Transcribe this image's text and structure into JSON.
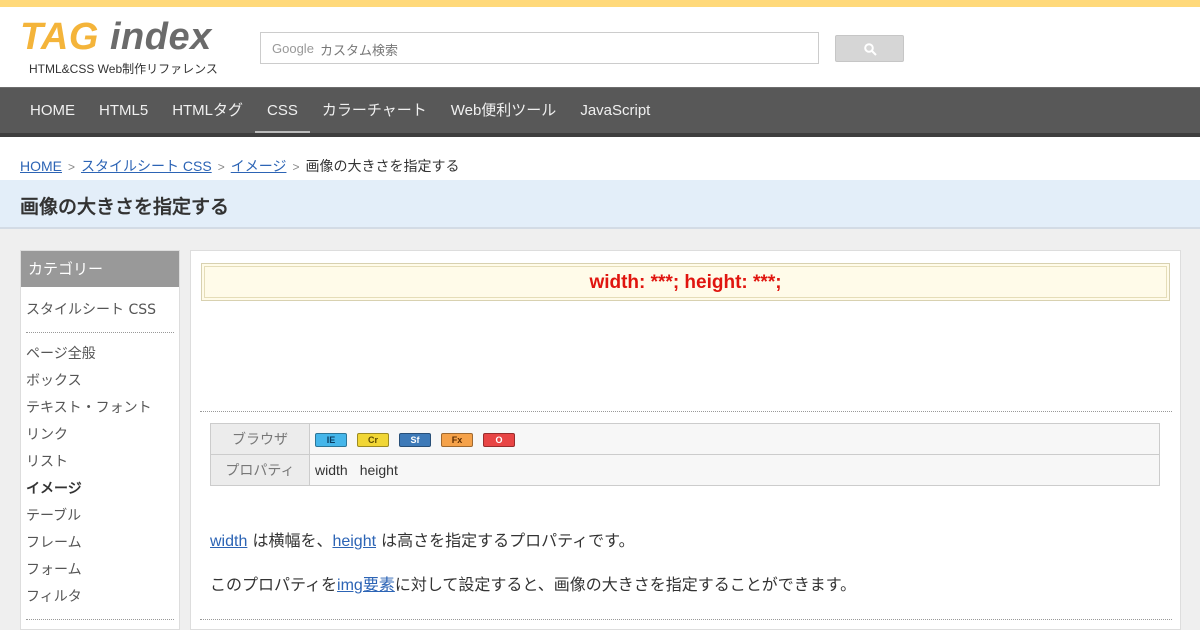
{
  "header": {
    "logo_tag": "TAG",
    "logo_index": "index",
    "tagline": "HTML&CSS Web制作リファレンス",
    "search_google": "Google",
    "search_placeholder": "カスタム検索"
  },
  "nav": {
    "items": [
      "HOME",
      "HTML5",
      "HTMLタグ",
      "CSS",
      "カラーチャート",
      "Web便利ツール",
      "JavaScript"
    ],
    "active": "CSS"
  },
  "breadcrumb": {
    "home": "HOME",
    "level1": "スタイルシート CSS",
    "level2": "イメージ",
    "current": "画像の大きさを指定する",
    "separator": ">"
  },
  "page_title": "画像の大きさを指定する",
  "sidebar": {
    "heading": "カテゴリー",
    "top_item": "スタイルシート CSS",
    "items": [
      "ページ全般",
      "ボックス",
      "テキスト・フォント",
      "リンク",
      "リスト",
      "イメージ",
      "テーブル",
      "フレーム",
      "フォーム",
      "フィルタ"
    ],
    "active": "イメージ"
  },
  "main": {
    "syntax": "width: ***; height: ***;",
    "table": {
      "browser_label": "ブラウザ",
      "property_label": "プロパティ",
      "browsers": [
        {
          "code": "IE",
          "color": "#45b6ea",
          "text": "#083b60"
        },
        {
          "code": "Cr",
          "color": "#f1d635",
          "text": "#5d4a00"
        },
        {
          "code": "Sf",
          "color": "#3e7ab8",
          "text": "#ffffff"
        },
        {
          "code": "Fx",
          "color": "#f5a24a",
          "text": "#5c2c00"
        },
        {
          "code": "O",
          "color": "#e84545",
          "text": "#ffffff"
        }
      ],
      "properties": [
        "width",
        "height"
      ]
    },
    "para1": {
      "link1": "width",
      "text1": " は横幅を、",
      "link2": "height",
      "text2": " は高さを指定するプロパティです。"
    },
    "para2": {
      "text1": "このプロパティを",
      "link": "img要素",
      "text2": "に対して設定すると、画像の大きさを指定することができます。"
    }
  }
}
